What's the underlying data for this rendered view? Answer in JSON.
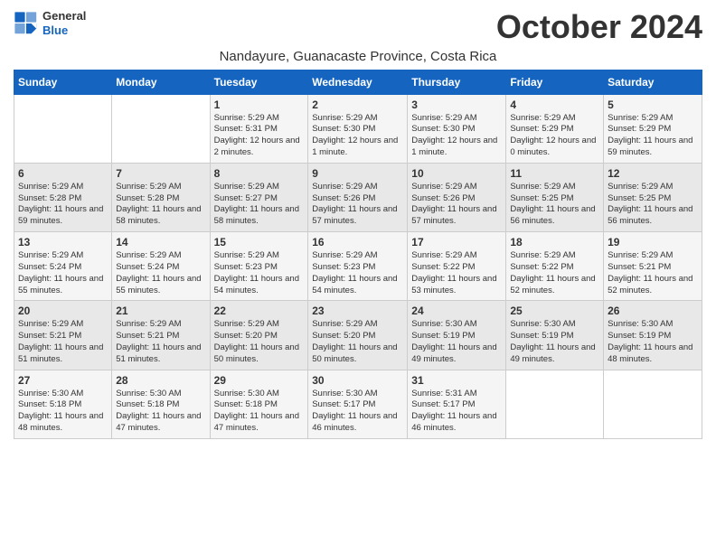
{
  "logo": {
    "line1": "General",
    "line2": "Blue"
  },
  "header": {
    "month_year": "October 2024",
    "subtitle": "Nandayure, Guanacaste Province, Costa Rica"
  },
  "days_of_week": [
    "Sunday",
    "Monday",
    "Tuesday",
    "Wednesday",
    "Thursday",
    "Friday",
    "Saturday"
  ],
  "weeks": [
    [
      {
        "day": "",
        "content": ""
      },
      {
        "day": "",
        "content": ""
      },
      {
        "day": "1",
        "content": "Sunrise: 5:29 AM\nSunset: 5:31 PM\nDaylight: 12 hours and 2 minutes."
      },
      {
        "day": "2",
        "content": "Sunrise: 5:29 AM\nSunset: 5:30 PM\nDaylight: 12 hours and 1 minute."
      },
      {
        "day": "3",
        "content": "Sunrise: 5:29 AM\nSunset: 5:30 PM\nDaylight: 12 hours and 1 minute."
      },
      {
        "day": "4",
        "content": "Sunrise: 5:29 AM\nSunset: 5:29 PM\nDaylight: 12 hours and 0 minutes."
      },
      {
        "day": "5",
        "content": "Sunrise: 5:29 AM\nSunset: 5:29 PM\nDaylight: 11 hours and 59 minutes."
      }
    ],
    [
      {
        "day": "6",
        "content": "Sunrise: 5:29 AM\nSunset: 5:28 PM\nDaylight: 11 hours and 59 minutes."
      },
      {
        "day": "7",
        "content": "Sunrise: 5:29 AM\nSunset: 5:28 PM\nDaylight: 11 hours and 58 minutes."
      },
      {
        "day": "8",
        "content": "Sunrise: 5:29 AM\nSunset: 5:27 PM\nDaylight: 11 hours and 58 minutes."
      },
      {
        "day": "9",
        "content": "Sunrise: 5:29 AM\nSunset: 5:26 PM\nDaylight: 11 hours and 57 minutes."
      },
      {
        "day": "10",
        "content": "Sunrise: 5:29 AM\nSunset: 5:26 PM\nDaylight: 11 hours and 57 minutes."
      },
      {
        "day": "11",
        "content": "Sunrise: 5:29 AM\nSunset: 5:25 PM\nDaylight: 11 hours and 56 minutes."
      },
      {
        "day": "12",
        "content": "Sunrise: 5:29 AM\nSunset: 5:25 PM\nDaylight: 11 hours and 56 minutes."
      }
    ],
    [
      {
        "day": "13",
        "content": "Sunrise: 5:29 AM\nSunset: 5:24 PM\nDaylight: 11 hours and 55 minutes."
      },
      {
        "day": "14",
        "content": "Sunrise: 5:29 AM\nSunset: 5:24 PM\nDaylight: 11 hours and 55 minutes."
      },
      {
        "day": "15",
        "content": "Sunrise: 5:29 AM\nSunset: 5:23 PM\nDaylight: 11 hours and 54 minutes."
      },
      {
        "day": "16",
        "content": "Sunrise: 5:29 AM\nSunset: 5:23 PM\nDaylight: 11 hours and 54 minutes."
      },
      {
        "day": "17",
        "content": "Sunrise: 5:29 AM\nSunset: 5:22 PM\nDaylight: 11 hours and 53 minutes."
      },
      {
        "day": "18",
        "content": "Sunrise: 5:29 AM\nSunset: 5:22 PM\nDaylight: 11 hours and 52 minutes."
      },
      {
        "day": "19",
        "content": "Sunrise: 5:29 AM\nSunset: 5:21 PM\nDaylight: 11 hours and 52 minutes."
      }
    ],
    [
      {
        "day": "20",
        "content": "Sunrise: 5:29 AM\nSunset: 5:21 PM\nDaylight: 11 hours and 51 minutes."
      },
      {
        "day": "21",
        "content": "Sunrise: 5:29 AM\nSunset: 5:21 PM\nDaylight: 11 hours and 51 minutes."
      },
      {
        "day": "22",
        "content": "Sunrise: 5:29 AM\nSunset: 5:20 PM\nDaylight: 11 hours and 50 minutes."
      },
      {
        "day": "23",
        "content": "Sunrise: 5:29 AM\nSunset: 5:20 PM\nDaylight: 11 hours and 50 minutes."
      },
      {
        "day": "24",
        "content": "Sunrise: 5:30 AM\nSunset: 5:19 PM\nDaylight: 11 hours and 49 minutes."
      },
      {
        "day": "25",
        "content": "Sunrise: 5:30 AM\nSunset: 5:19 PM\nDaylight: 11 hours and 49 minutes."
      },
      {
        "day": "26",
        "content": "Sunrise: 5:30 AM\nSunset: 5:19 PM\nDaylight: 11 hours and 48 minutes."
      }
    ],
    [
      {
        "day": "27",
        "content": "Sunrise: 5:30 AM\nSunset: 5:18 PM\nDaylight: 11 hours and 48 minutes."
      },
      {
        "day": "28",
        "content": "Sunrise: 5:30 AM\nSunset: 5:18 PM\nDaylight: 11 hours and 47 minutes."
      },
      {
        "day": "29",
        "content": "Sunrise: 5:30 AM\nSunset: 5:18 PM\nDaylight: 11 hours and 47 minutes."
      },
      {
        "day": "30",
        "content": "Sunrise: 5:30 AM\nSunset: 5:17 PM\nDaylight: 11 hours and 46 minutes."
      },
      {
        "day": "31",
        "content": "Sunrise: 5:31 AM\nSunset: 5:17 PM\nDaylight: 11 hours and 46 minutes."
      },
      {
        "day": "",
        "content": ""
      },
      {
        "day": "",
        "content": ""
      }
    ]
  ]
}
